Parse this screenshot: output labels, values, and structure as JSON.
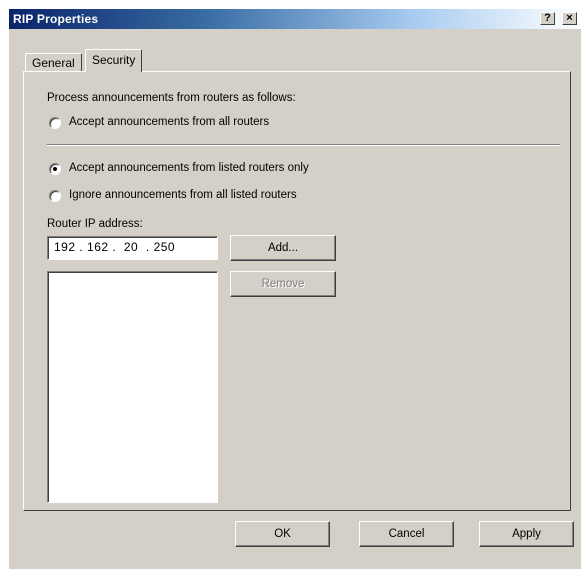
{
  "window": {
    "title": "RIP Properties",
    "help_glyph": "?",
    "close_glyph": "×"
  },
  "tabs": [
    {
      "label": "General",
      "active": false
    },
    {
      "label": "Security",
      "active": true
    }
  ],
  "security": {
    "process_label": "Process announcements from routers as follows:",
    "options": [
      {
        "label": "Accept announcements from all routers",
        "selected": false
      },
      {
        "label": "Accept announcements from listed routers only",
        "selected": true
      },
      {
        "label": "Ignore announcements from all listed routers",
        "selected": false
      }
    ],
    "router_ip_label": "Router IP address:",
    "ip_value": "192 . 162 .  20  . 250",
    "add_label": "Add...",
    "remove_label": "Remove",
    "router_list": []
  },
  "footer": {
    "ok_label": "OK",
    "cancel_label": "Cancel",
    "apply_label": "Apply"
  }
}
